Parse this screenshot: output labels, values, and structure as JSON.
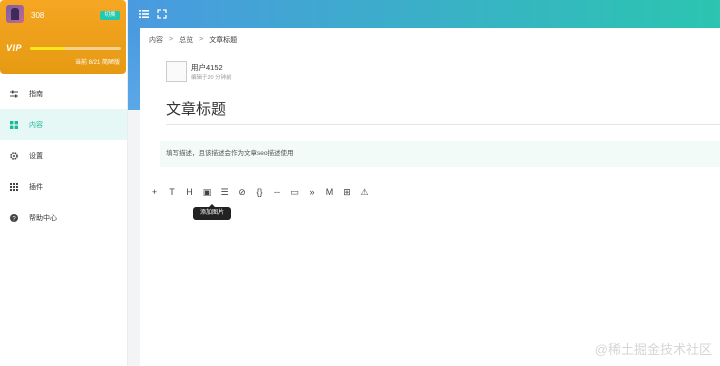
{
  "sidebar": {
    "user": {
      "name": "308",
      "switch_label": "切换",
      "vip_logo": "VIP",
      "progress_text": "当前 8/21 简陋版",
      "progress_fraction": 0.38
    },
    "items": [
      {
        "label": "指南",
        "icon": "sliders-icon",
        "active": false
      },
      {
        "label": "内容",
        "icon": "grid-icon",
        "active": true
      },
      {
        "label": "设置",
        "icon": "gear-icon",
        "active": false
      },
      {
        "label": "插件",
        "icon": "apps-icon",
        "active": false
      },
      {
        "label": "帮助中心",
        "icon": "help-icon",
        "active": false
      }
    ]
  },
  "header": {
    "icons": [
      "menu-icon",
      "fullscreen-icon"
    ]
  },
  "breadcrumb": {
    "items": [
      "内容",
      "总览",
      "文章标题"
    ],
    "separator": ">"
  },
  "editor": {
    "author": {
      "name": "用户4152",
      "meta": "编辑于20 分钟前"
    },
    "title": "文章标题",
    "description_placeholder": "填写描述，且该描述会作为文章seo描述使用",
    "toolbar": [
      {
        "icon": "plus-icon",
        "glyph": "+"
      },
      {
        "icon": "text-icon",
        "glyph": "T"
      },
      {
        "icon": "heading-icon",
        "glyph": "H"
      },
      {
        "icon": "image-icon",
        "glyph": "▣"
      },
      {
        "icon": "list-icon",
        "glyph": "☰"
      },
      {
        "icon": "check-circle-icon",
        "glyph": "⊘"
      },
      {
        "icon": "code-icon",
        "glyph": "{}"
      },
      {
        "icon": "divider-icon",
        "glyph": "--"
      },
      {
        "icon": "video-icon",
        "glyph": "▭"
      },
      {
        "icon": "quote-icon",
        "glyph": "»"
      },
      {
        "icon": "markdown-icon",
        "glyph": "M"
      },
      {
        "icon": "table-icon",
        "glyph": "⊞"
      },
      {
        "icon": "warning-icon",
        "glyph": "⚠"
      }
    ],
    "tooltip": "添加图片"
  },
  "watermark": "@稀土掘金技术社区",
  "colors": {
    "vip_gradient_start": "#f5a623",
    "header_gradient_start": "#4a9ae0",
    "header_gradient_end": "#2bc5b0",
    "accent": "#1bb99a"
  }
}
